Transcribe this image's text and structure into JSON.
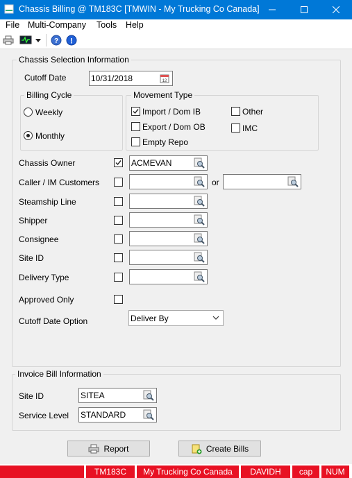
{
  "window": {
    "title": "Chassis Billing @ TM183C [TMWIN - My Trucking Co Canada]"
  },
  "menu": {
    "items": [
      "File",
      "Multi-Company",
      "Tools",
      "Help"
    ]
  },
  "toolbar": {
    "icons": [
      "printer-icon",
      "monitor-icon",
      "help-icon",
      "info-icon"
    ]
  },
  "chassis_selection": {
    "title": "Chassis Selection Information",
    "cutoff_date_label": "Cutoff Date",
    "cutoff_date_value": "10/31/2018",
    "billing_cycle": {
      "title": "Billing Cycle",
      "weekly": "Weekly",
      "monthly": "Monthly",
      "selected": "Monthly"
    },
    "movement_type": {
      "title": "Movement Type",
      "import_dom_ib": "Import / Dom IB",
      "export_dom_ob": "Export / Dom OB",
      "empty_repo": "Empty Repo",
      "other": "Other",
      "imc": "IMC",
      "checked": [
        "Import / Dom IB"
      ]
    },
    "chassis_owner": {
      "label": "Chassis Owner",
      "checked": true,
      "value": "ACMEVAN"
    },
    "caller_im": {
      "label": "Caller / IM Customers",
      "checked": false,
      "value": "",
      "or_label": "or",
      "value2": ""
    },
    "steamship_line": {
      "label": "Steamship Line",
      "checked": false,
      "value": ""
    },
    "shipper": {
      "label": "Shipper",
      "checked": false,
      "value": ""
    },
    "consignee": {
      "label": "Consignee",
      "checked": false,
      "value": ""
    },
    "site_id": {
      "label": "Site ID",
      "checked": false,
      "value": ""
    },
    "delivery_type": {
      "label": "Delivery Type",
      "checked": false,
      "value": ""
    },
    "approved_only": {
      "label": "Approved Only",
      "checked": false
    },
    "cutoff_date_option": {
      "label": "Cutoff Date Option",
      "value": "Deliver By"
    }
  },
  "invoice_bill": {
    "title": "Invoice Bill Information",
    "site_id": {
      "label": "Site ID",
      "value": "SITEA"
    },
    "service_level": {
      "label": "Service Level",
      "value": "STANDARD"
    }
  },
  "buttons": {
    "report": "Report",
    "create_bills": "Create Bills"
  },
  "statusbar": [
    "TM183C",
    "My Trucking Co Canada",
    "DAVIDH",
    "cap",
    "NUM"
  ],
  "colors": {
    "titlebar": "#0078d7",
    "status": "#e81123"
  }
}
